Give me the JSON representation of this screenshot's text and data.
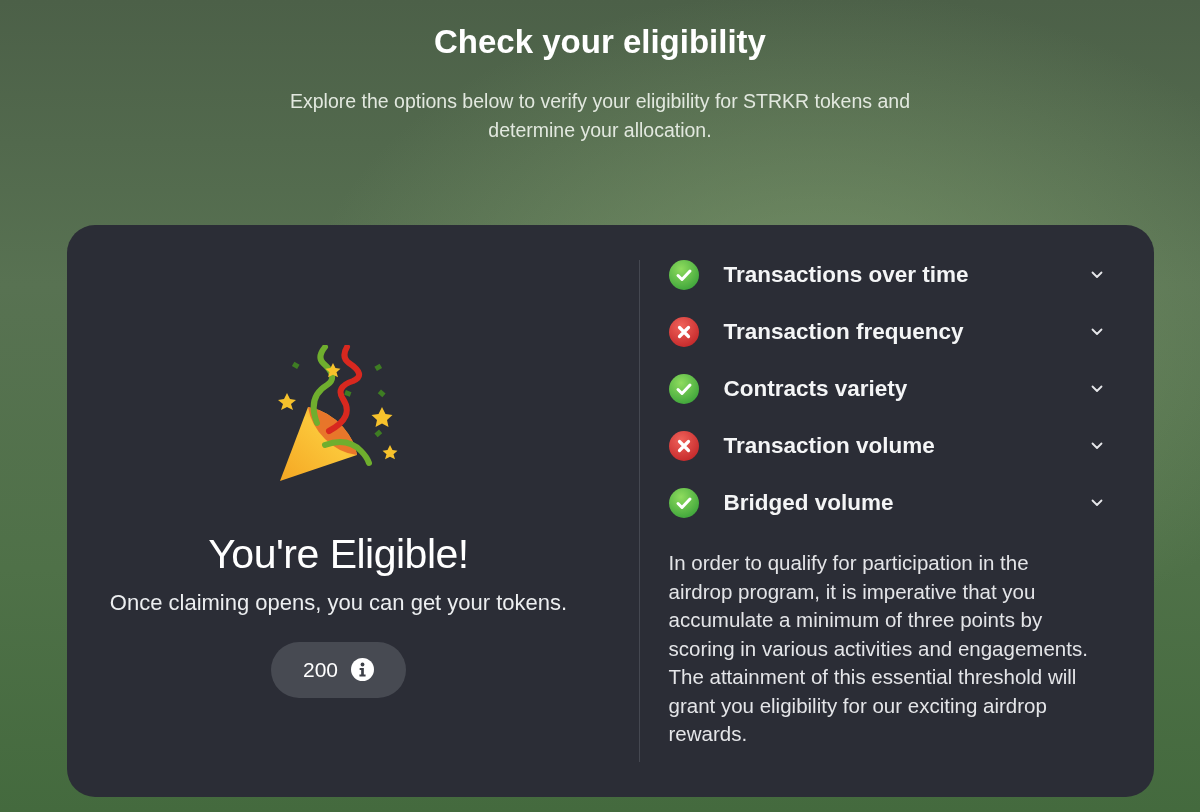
{
  "page": {
    "title": "Check your eligibility",
    "subtitle": "Explore the options below to verify your eligibility for STRKR tokens and determine your allocation."
  },
  "result": {
    "heading": "You're Eligible!",
    "message": "Once claiming opens, you can get your tokens.",
    "amount": "200"
  },
  "criteria": [
    {
      "label": "Transactions over time",
      "met": true,
      "expanded": false
    },
    {
      "label": "Transaction frequency",
      "met": false,
      "expanded": false
    },
    {
      "label": "Contracts variety",
      "met": true,
      "expanded": false
    },
    {
      "label": "Transaction volume",
      "met": false,
      "expanded": false
    },
    {
      "label": "Bridged volume",
      "met": true,
      "expanded": false
    }
  ],
  "note": "In order to qualify for participation in the airdrop program, it is imperative that you accumulate a minimum of three points by scoring in various activities and engagements. The attainment of this essential threshold will grant you eligibility for our exciting airdrop rewards."
}
